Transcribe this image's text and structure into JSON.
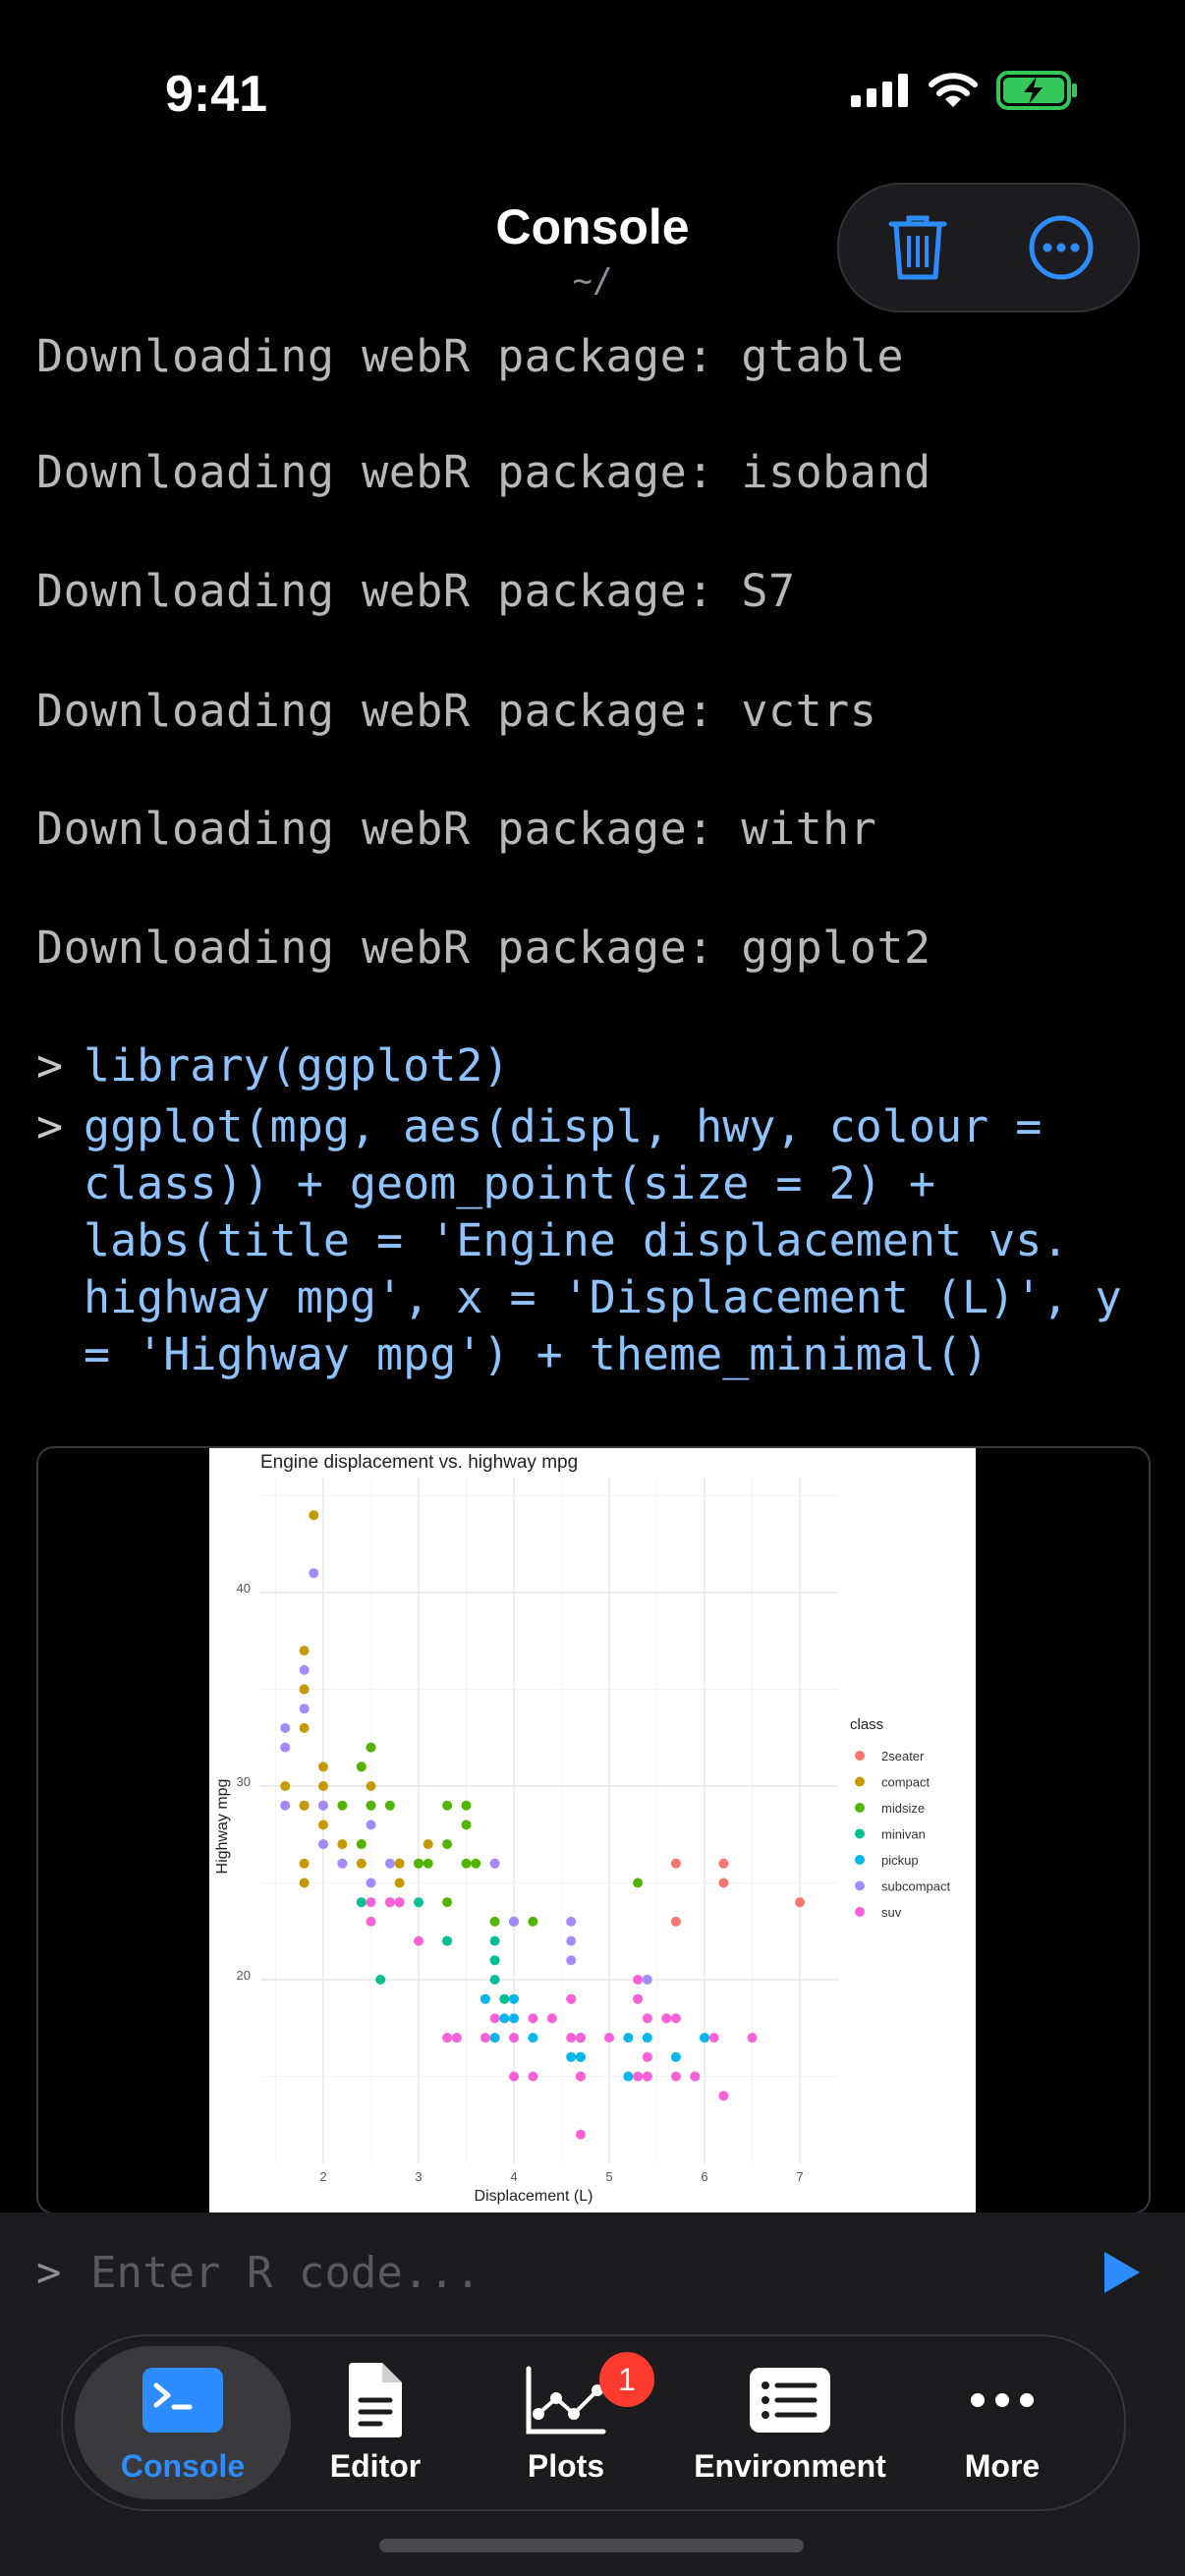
{
  "status": {
    "time": "9:41"
  },
  "nav": {
    "title": "Console",
    "subtitle": "~/"
  },
  "console": {
    "output_lines": [
      "Downloading webR package: gtable",
      "Downloading webR package: isoband",
      "Downloading webR package: S7",
      "Downloading webR package: vctrs",
      "Downloading webR package: withr",
      "Downloading webR package: ggplot2"
    ],
    "prompt_symbol": ">",
    "commands": [
      "library(ggplot2)",
      "ggplot(mpg, aes(displ, hwy, colour = class)) + geom_point(size = 2) + labs(title = 'Engine displacement vs. highway mpg', x = 'Displacement (L)', y = 'Highway mpg') + theme_minimal()"
    ]
  },
  "plot": {
    "title": "Engine displacement vs. highway mpg",
    "xlabel": "Displacement (L)",
    "ylabel": "Highway mpg",
    "x_ticks": [
      "2",
      "3",
      "4",
      "5",
      "6",
      "7"
    ],
    "y_ticks": [
      "20",
      "30",
      "40"
    ],
    "legend_title": "class",
    "legend": [
      {
        "name": "2seater",
        "color": "#F8766D"
      },
      {
        "name": "compact",
        "color": "#C49A00"
      },
      {
        "name": "midsize",
        "color": "#53B400"
      },
      {
        "name": "minivan",
        "color": "#00C094"
      },
      {
        "name": "pickup",
        "color": "#00B6EB"
      },
      {
        "name": "subcompact",
        "color": "#A58AFF"
      },
      {
        "name": "suv",
        "color": "#FB61D7"
      }
    ]
  },
  "chart_data": {
    "type": "scatter",
    "title": "Engine displacement vs. highway mpg",
    "xlabel": "Displacement (L)",
    "ylabel": "Highway mpg",
    "xlim": [
      1.6,
      7.0
    ],
    "ylim": [
      12,
      44
    ],
    "grid": true,
    "legend_position": "right",
    "series": [
      {
        "name": "2seater",
        "points": [
          [
            5.7,
            26
          ],
          [
            5.7,
            23
          ],
          [
            6.2,
            26
          ],
          [
            6.2,
            25
          ],
          [
            7.0,
            24
          ]
        ]
      },
      {
        "name": "compact",
        "points": [
          [
            1.8,
            29
          ],
          [
            1.8,
            29
          ],
          [
            2.0,
            31
          ],
          [
            2.0,
            30
          ],
          [
            2.8,
            26
          ],
          [
            2.8,
            26
          ],
          [
            3.1,
            27
          ],
          [
            1.8,
            26
          ],
          [
            1.8,
            25
          ],
          [
            2.0,
            28
          ],
          [
            2.0,
            27
          ],
          [
            2.8,
            25
          ],
          [
            1.9,
            44
          ],
          [
            2.0,
            29
          ],
          [
            2.5,
            30
          ],
          [
            2.5,
            32
          ],
          [
            2.2,
            27
          ],
          [
            2.4,
            26
          ],
          [
            2.4,
            27
          ],
          [
            2.5,
            29
          ],
          [
            2.7,
            24
          ],
          [
            1.8,
            33
          ],
          [
            1.8,
            35
          ],
          [
            1.8,
            37
          ],
          [
            1.8,
            35
          ],
          [
            2.2,
            26
          ],
          [
            2.4,
            31
          ],
          [
            1.6,
            30
          ]
        ]
      },
      {
        "name": "midsize",
        "points": [
          [
            2.4,
            27
          ],
          [
            2.5,
            29
          ],
          [
            3.0,
            26
          ],
          [
            3.1,
            26
          ],
          [
            3.3,
            24
          ],
          [
            3.5,
            26
          ],
          [
            3.5,
            29
          ],
          [
            3.6,
            26
          ],
          [
            3.8,
            26
          ],
          [
            2.7,
            29
          ],
          [
            2.4,
            31
          ],
          [
            2.5,
            32
          ],
          [
            3.3,
            29
          ],
          [
            3.3,
            27
          ],
          [
            3.5,
            28
          ],
          [
            3.8,
            23
          ],
          [
            4.0,
            23
          ],
          [
            4.2,
            23
          ],
          [
            5.3,
            25
          ],
          [
            2.8,
            24
          ],
          [
            2.2,
            29
          ],
          [
            3.0,
            26
          ]
        ]
      },
      {
        "name": "minivan",
        "points": [
          [
            2.4,
            24
          ],
          [
            3.0,
            24
          ],
          [
            3.3,
            22
          ],
          [
            3.3,
            22
          ],
          [
            3.8,
            22
          ],
          [
            3.8,
            21
          ],
          [
            4.0,
            23
          ],
          [
            2.6,
            20
          ],
          [
            3.8,
            20
          ],
          [
            3.9,
            19
          ],
          [
            4.0,
            17
          ]
        ]
      },
      {
        "name": "pickup",
        "points": [
          [
            3.7,
            19
          ],
          [
            3.9,
            18
          ],
          [
            4.7,
            17
          ],
          [
            4.7,
            16
          ],
          [
            5.2,
            15
          ],
          [
            5.7,
            16
          ],
          [
            5.9,
            15
          ],
          [
            4.0,
            19
          ],
          [
            4.7,
            17
          ],
          [
            5.4,
            15
          ],
          [
            3.4,
            17
          ],
          [
            4.0,
            18
          ],
          [
            4.6,
            16
          ],
          [
            5.4,
            17
          ],
          [
            6.0,
            17
          ],
          [
            3.8,
            17
          ],
          [
            4.2,
            17
          ],
          [
            4.7,
            16
          ],
          [
            5.2,
            17
          ]
        ]
      },
      {
        "name": "subcompact",
        "points": [
          [
            1.6,
            33
          ],
          [
            1.6,
            32
          ],
          [
            1.8,
            36
          ],
          [
            1.8,
            34
          ],
          [
            1.9,
            41
          ],
          [
            2.0,
            29
          ],
          [
            2.0,
            27
          ],
          [
            2.2,
            26
          ],
          [
            2.5,
            25
          ],
          [
            2.5,
            28
          ],
          [
            2.7,
            26
          ],
          [
            3.8,
            26
          ],
          [
            4.0,
            23
          ],
          [
            4.6,
            23
          ],
          [
            4.6,
            22
          ],
          [
            4.6,
            21
          ],
          [
            4.6,
            19
          ],
          [
            5.4,
            20
          ],
          [
            1.6,
            29
          ],
          [
            2.0,
            29
          ]
        ]
      },
      {
        "name": "suv",
        "points": [
          [
            2.5,
            23
          ],
          [
            3.0,
            22
          ],
          [
            3.3,
            17
          ],
          [
            3.4,
            17
          ],
          [
            3.7,
            17
          ],
          [
            4.0,
            17
          ],
          [
            4.0,
            15
          ],
          [
            4.2,
            18
          ],
          [
            4.4,
            18
          ],
          [
            4.6,
            19
          ],
          [
            4.7,
            17
          ],
          [
            4.7,
            15
          ],
          [
            5.3,
            20
          ],
          [
            5.3,
            19
          ],
          [
            5.4,
            18
          ],
          [
            5.6,
            18
          ],
          [
            5.7,
            18
          ],
          [
            5.9,
            15
          ],
          [
            6.1,
            17
          ],
          [
            6.2,
            14
          ],
          [
            6.5,
            17
          ],
          [
            4.7,
            12
          ],
          [
            5.3,
            15
          ],
          [
            5.0,
            17
          ],
          [
            4.6,
            17
          ],
          [
            5.4,
            15
          ],
          [
            5.7,
            15
          ],
          [
            2.7,
            24
          ],
          [
            5.4,
            16
          ],
          [
            4.7,
            15
          ],
          [
            3.8,
            18
          ],
          [
            2.5,
            24
          ],
          [
            4.2,
            15
          ],
          [
            2.8,
            24
          ]
        ]
      }
    ]
  },
  "input": {
    "prompt": ">",
    "placeholder": "Enter R code..."
  },
  "tabs": [
    {
      "label": "Console",
      "active": true
    },
    {
      "label": "Editor"
    },
    {
      "label": "Plots",
      "badge": "1"
    },
    {
      "label": "Environment"
    },
    {
      "label": "More"
    }
  ],
  "colors": {
    "accent": "#2D8CFF",
    "badge": "#FF3B30",
    "battery": "#34C759"
  }
}
